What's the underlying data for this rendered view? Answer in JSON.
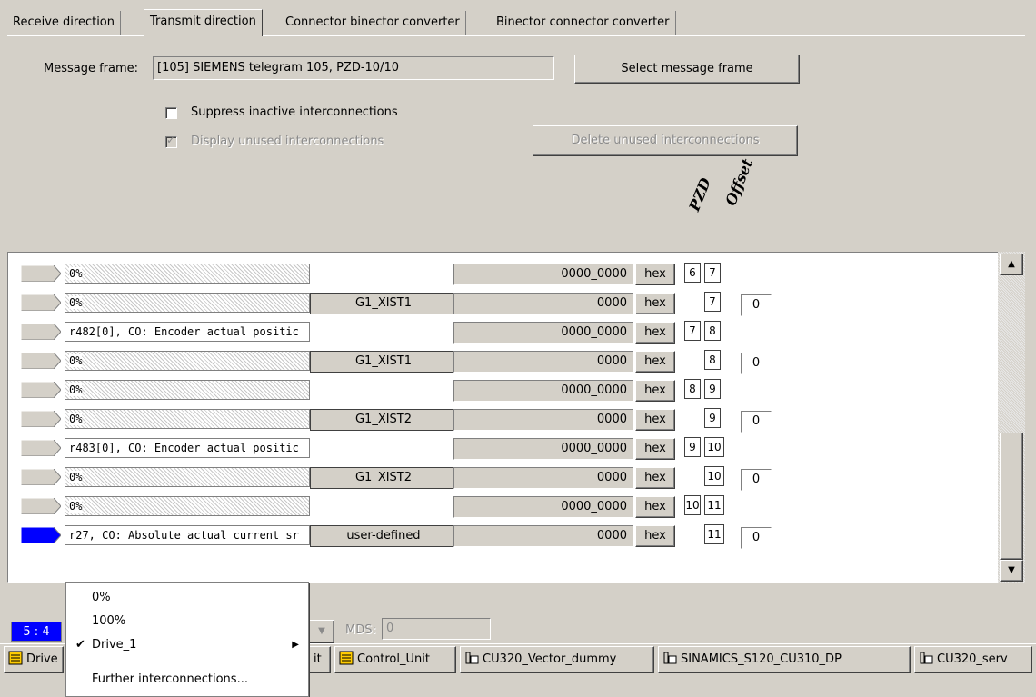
{
  "tabs": [
    "Receive direction",
    "Transmit direction",
    "Connector binector converter",
    "Binector connector converter"
  ],
  "frame": {
    "label": "Message frame:",
    "value": "[105] SIEMENS telegram 105, PZD-10/10",
    "select_button": "Select message frame",
    "suppress_label": "Suppress inactive interconnections",
    "display_unused_label": "Display unused interconnections",
    "delete_unused_button": "Delete unused interconnections"
  },
  "headers": {
    "pzd": "PZD",
    "offset": "Offset"
  },
  "rows": [
    {
      "signal": "0%",
      "name": "",
      "value": "0000_0000",
      "hex": "hex",
      "pzd1": "6",
      "pzd2": "7",
      "offset": ""
    },
    {
      "signal": "0%",
      "name": "G1_XIST1",
      "value": "0000",
      "hex": "hex",
      "pzd1": "",
      "pzd2": "7",
      "offset": "0"
    },
    {
      "signal": "r482[0], CO: Encoder actual positic",
      "name": "",
      "value": "0000_0000",
      "hex": "hex",
      "pzd1": "7",
      "pzd2": "8",
      "offset": ""
    },
    {
      "signal": "0%",
      "name": "G1_XIST1",
      "value": "0000",
      "hex": "hex",
      "pzd1": "",
      "pzd2": "8",
      "offset": "0"
    },
    {
      "signal": "0%",
      "name": "",
      "value": "0000_0000",
      "hex": "hex",
      "pzd1": "8",
      "pzd2": "9",
      "offset": ""
    },
    {
      "signal": "0%",
      "name": "G1_XIST2",
      "value": "0000",
      "hex": "hex",
      "pzd1": "",
      "pzd2": "9",
      "offset": "0"
    },
    {
      "signal": "r483[0], CO: Encoder actual positic",
      "name": "",
      "value": "0000_0000",
      "hex": "hex",
      "pzd1": "9",
      "pzd2": "10",
      "offset": ""
    },
    {
      "signal": "0%",
      "name": "G1_XIST2",
      "value": "0000",
      "hex": "hex",
      "pzd1": "",
      "pzd2": "10",
      "offset": "0"
    },
    {
      "signal": "0%",
      "name": "",
      "value": "0000_0000",
      "hex": "hex",
      "pzd1": "10",
      "pzd2": "11",
      "offset": ""
    },
    {
      "signal": "r27, CO: Absolute actual current sr",
      "name": "user-defined",
      "value": "0000",
      "hex": "hex",
      "pzd1": "",
      "pzd2": "11",
      "offset": "0"
    }
  ],
  "context_menu": {
    "items": [
      "0%",
      "100%",
      "Drive_1",
      "Further interconnections..."
    ],
    "checked": "Drive_1"
  },
  "bottom": {
    "status": "5 : 4",
    "mds_label": "MDS:",
    "mds_value": "0"
  },
  "taskbar": [
    "Drive",
    "it",
    "Control_Unit",
    "CU320_Vector_dummy",
    "SINAMICS_S120_CU310_DP",
    "CU320_serv"
  ],
  "colors": {
    "selected_row_icon": "#0000ff",
    "status_bg": "#0000ff"
  }
}
